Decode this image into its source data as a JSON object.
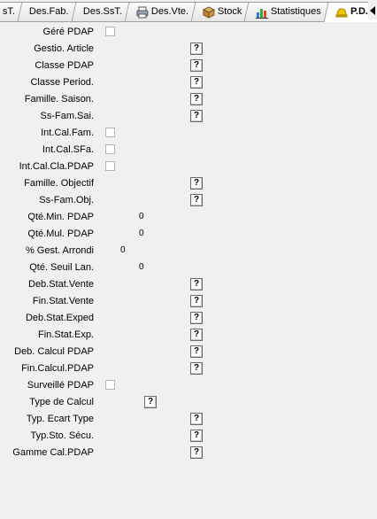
{
  "tabs": [
    {
      "label": "sT.",
      "icon": null,
      "active": false
    },
    {
      "label": "Des.Fab.",
      "icon": null,
      "active": false
    },
    {
      "label": "Des.SsT.",
      "icon": null,
      "active": false
    },
    {
      "label": "Des.Vte.",
      "icon": "printer-icon",
      "active": false
    },
    {
      "label": "Stock",
      "icon": "box-icon",
      "active": false
    },
    {
      "label": "Statistiques",
      "icon": "bar-chart-icon",
      "active": false
    },
    {
      "label": "P.D.A.P.",
      "icon": "hard-hat-icon",
      "active": true
    }
  ],
  "help_symbol": "?",
  "fields": [
    {
      "label": "Géré PDAP",
      "type": "checkbox"
    },
    {
      "label": "Gestio. Article",
      "type": "help"
    },
    {
      "label": "Classe PDAP",
      "type": "help"
    },
    {
      "label": "Classe Period.",
      "type": "help"
    },
    {
      "label": "Famille. Saison.",
      "type": "help"
    },
    {
      "label": "Ss-Fam.Sai.",
      "type": "help"
    },
    {
      "label": "Int.Cal.Fam.",
      "type": "checkbox"
    },
    {
      "label": "Int.Cal.SFa.",
      "type": "checkbox"
    },
    {
      "label": "Int.Cal.Cla.PDAP",
      "type": "checkbox"
    },
    {
      "label": "Famille. Objectif",
      "type": "help"
    },
    {
      "label": "Ss-Fam.Obj.",
      "type": "help"
    },
    {
      "label": "Qté.Min. PDAP",
      "type": "value",
      "value": "0"
    },
    {
      "label": "Qté.Mul. PDAP",
      "type": "value",
      "value": "0"
    },
    {
      "label": "% Gest. Arrondi",
      "type": "value",
      "value": "0"
    },
    {
      "label": "Qté. Seuil Lan.",
      "type": "value",
      "value": "0"
    },
    {
      "label": "Deb.Stat.Vente",
      "type": "help"
    },
    {
      "label": "Fin.Stat.Vente",
      "type": "help"
    },
    {
      "label": "Deb.Stat.Exped",
      "type": "help"
    },
    {
      "label": "Fin.Stat.Exp.",
      "type": "help"
    },
    {
      "label": "Deb. Calcul PDAP",
      "type": "help"
    },
    {
      "label": "Fin.Calcul.PDAP",
      "type": "help"
    },
    {
      "label": "Surveillé PDAP",
      "type": "checkbox"
    },
    {
      "label": "Type de Calcul",
      "type": "help"
    },
    {
      "label": "Typ. Ecart Type",
      "type": "help"
    },
    {
      "label": "Typ.Sto. Sécu.",
      "type": "help"
    },
    {
      "label": "Gamme Cal.PDAP",
      "type": "help"
    }
  ]
}
